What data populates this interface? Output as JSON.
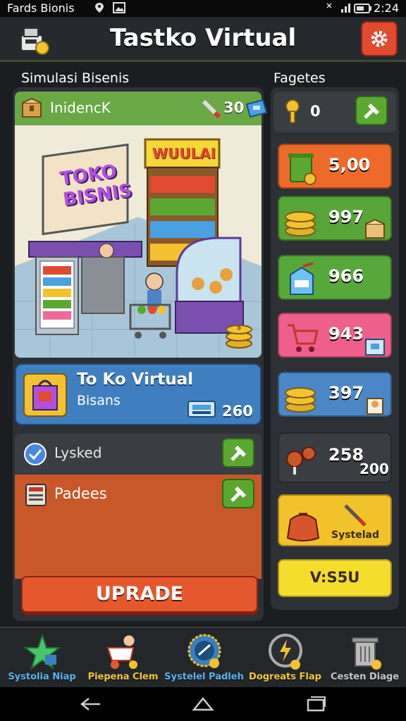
{
  "status": {
    "left": "Fards Bionis",
    "time": "2:24"
  },
  "header": {
    "title": "Tastko Virtual"
  },
  "main": {
    "section_label": "Simulasi Bisenis",
    "scene_card": {
      "label": "InidencK",
      "count": "30"
    },
    "scene_signs": {
      "store": "TOKO BISNIS",
      "shelf": "WUULAI"
    },
    "toko_card": {
      "title": "To Ko Virtual",
      "subtitle": "Bisans",
      "value": "260"
    },
    "lysked": {
      "label": "Lysked"
    },
    "padees": {
      "label": "Padees"
    },
    "upgrade_label": "UPRADE"
  },
  "side": {
    "label": "Fagetes",
    "top": {
      "value": "0"
    },
    "cards": [
      {
        "value": "5,00",
        "color": "#ee6a2a"
      },
      {
        "value": "997",
        "color": "#58a537"
      },
      {
        "value": "966",
        "color": "#57a83a"
      },
      {
        "value": "943",
        "color": "#ee5f8c"
      },
      {
        "value": "397",
        "color": "#4b86c6"
      },
      {
        "value": "258",
        "extra": "200",
        "color": "#3a3d42"
      },
      {
        "value": "Systelad",
        "color": "#f1c22a"
      },
      {
        "value": "V:S5U",
        "color": "#f4dd2d"
      }
    ]
  },
  "bottom_nav": [
    {
      "label": "Systolia Niap",
      "color": "#58b4f0"
    },
    {
      "label": "Piepena Clem",
      "color": "#f5c63a"
    },
    {
      "label": "Systelel Padleh",
      "color": "#58b4f0"
    },
    {
      "label": "Dogreats Flap",
      "color": "#f5c63a"
    },
    {
      "label": "Cesten Diage",
      "color": "#c8c8c8"
    }
  ]
}
